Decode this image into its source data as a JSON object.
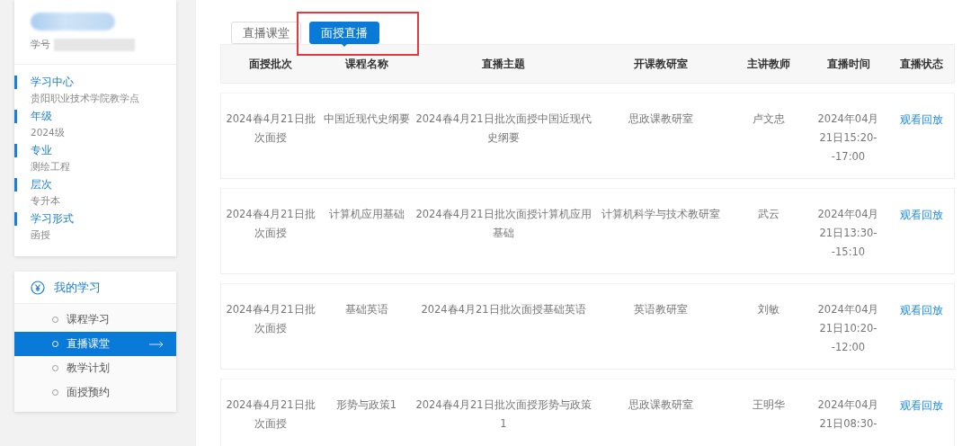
{
  "profile": {
    "id_label": "学号"
  },
  "info": [
    {
      "label": "学习中心",
      "value": "贵阳职业技术学院教学点"
    },
    {
      "label": "年级",
      "value": "2024级"
    },
    {
      "label": "专业",
      "value": "测绘工程"
    },
    {
      "label": "层次",
      "value": "专升本"
    },
    {
      "label": "学习形式",
      "value": "函授"
    }
  ],
  "menu": {
    "title": "我的学习",
    "items": [
      {
        "label": "课程学习",
        "selected": false
      },
      {
        "label": "直播课堂",
        "selected": true
      },
      {
        "label": "教学计划",
        "selected": false
      },
      {
        "label": "面授预约",
        "selected": false
      }
    ]
  },
  "tabs": [
    {
      "label": "直播课堂",
      "selected": false,
      "highlighted": false
    },
    {
      "label": "面授直播",
      "selected": true,
      "highlighted": true
    }
  ],
  "table": {
    "columns": [
      "面授批次",
      "课程名称",
      "直播主题",
      "开课教研室",
      "主讲教师",
      "直播时间",
      "直播状态"
    ],
    "rows": [
      {
        "cells": [
          "2024春4月21日批次面授",
          "中国近现代史纲要",
          "2024春4月21日批次面授中国近现代史纲要",
          "思政课教研室",
          "卢文忠",
          "2024年04月21日15:20--17:00"
        ],
        "action": "观看回放"
      },
      {
        "cells": [
          "2024春4月21日批次面授",
          "计算机应用基础",
          "2024春4月21日批次面授计算机应用基础",
          "计算机科学与技术教研室",
          "武云",
          "2024年04月21日13:30--15:10"
        ],
        "action": "观看回放"
      },
      {
        "cells": [
          "2024春4月21日批次面授",
          "基础英语",
          "2024春4月21日批次面授基础英语",
          "英语教研室",
          "刘敏",
          "2024年04月21日10:20--12:00"
        ],
        "action": "观看回放"
      },
      {
        "cells": [
          "2024春4月21日批次面授",
          "形势与政策1",
          "2024春4月21日批次面授形势与政策1",
          "思政课教研室",
          "王明华",
          "2024年04月21日08:30-"
        ],
        "action": "观看回放"
      }
    ]
  }
}
